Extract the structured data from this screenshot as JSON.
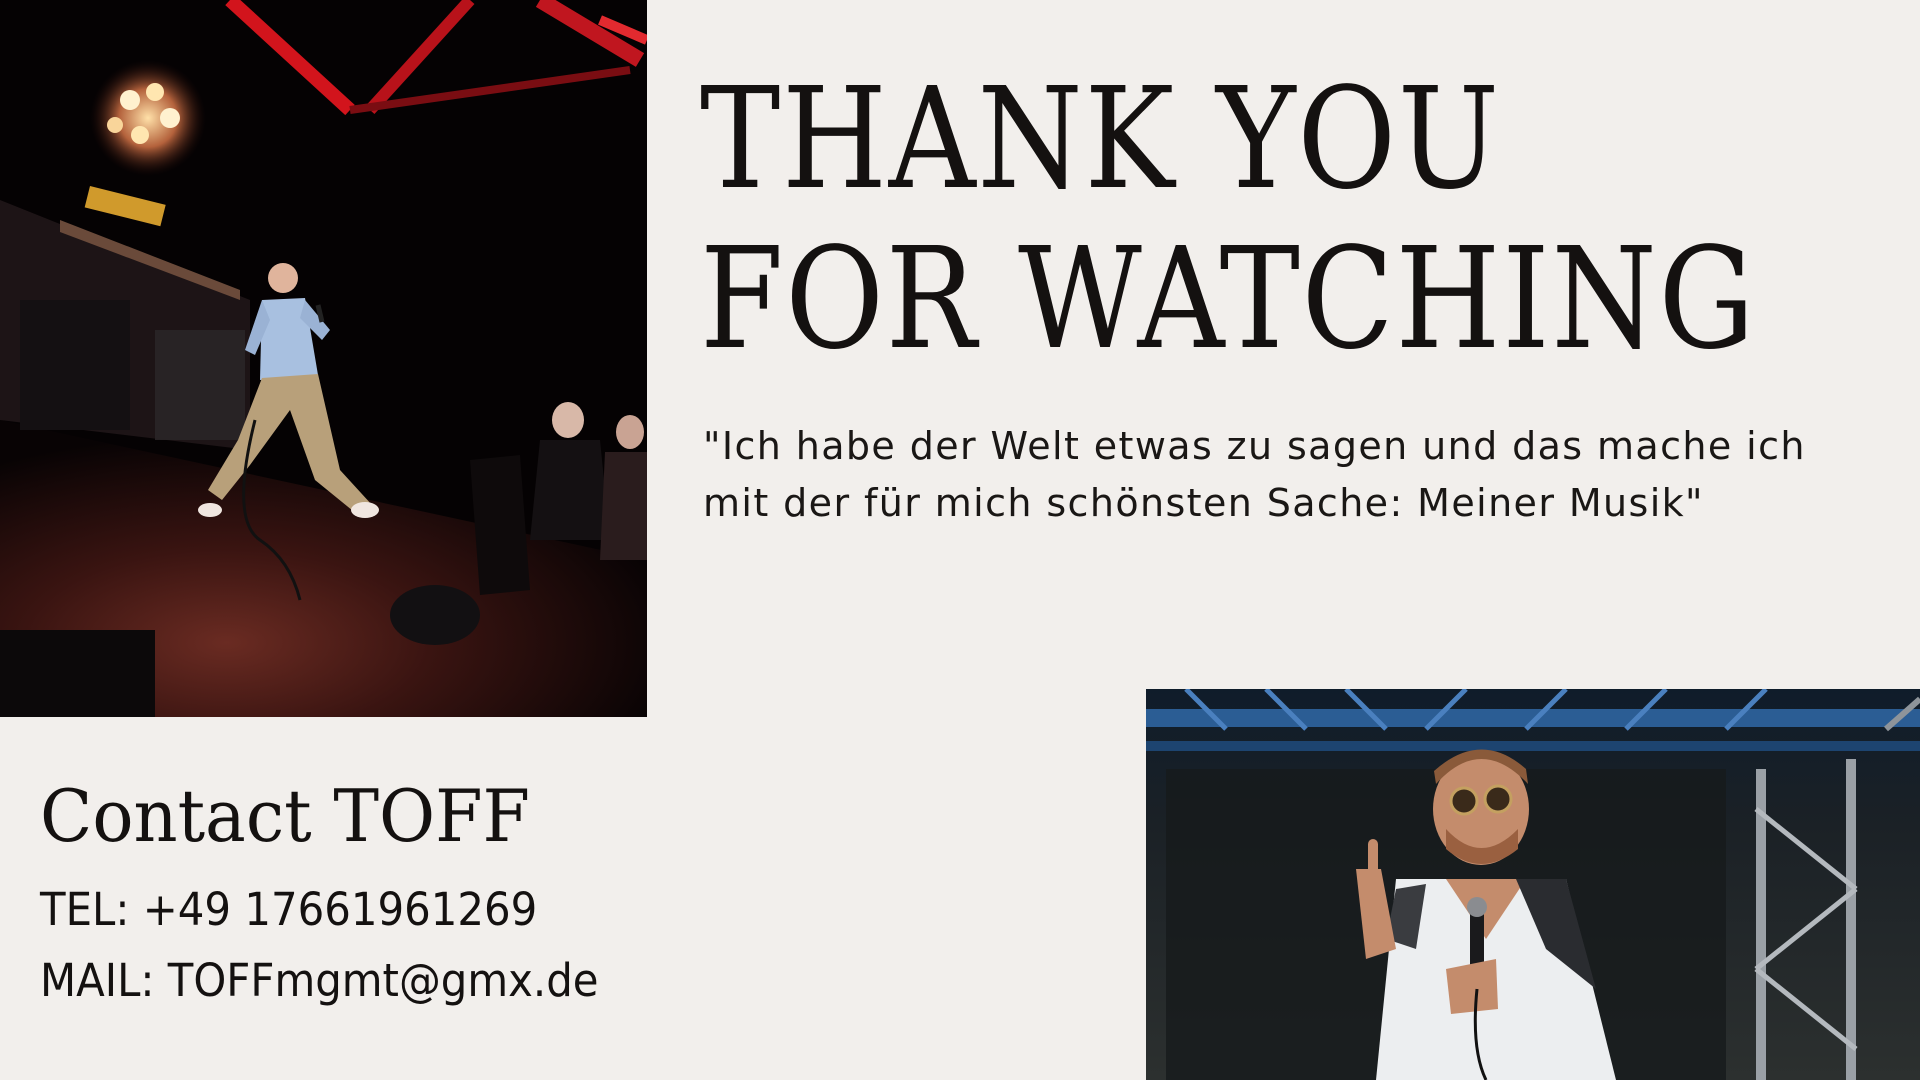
{
  "headline": {
    "line1": "THANK YOU",
    "line2": "FOR WATCHING"
  },
  "quote": {
    "line1": "\"Ich habe der Welt etwas zu sagen und das mache ich",
    "line2": "mit der für mich schönsten Sache: Meiner Musik\""
  },
  "contact": {
    "title": "Contact TOFF",
    "tel": "TEL: +49 17661961269",
    "mail": "MAIL: TOFFmgmt@gmx.de"
  },
  "photos": {
    "stage_photo": "photo-stage-club",
    "portrait_photo": "photo-performer-microphone"
  },
  "colors": {
    "background": "#f2efec",
    "text": "#141110",
    "stage_red": "#c0161f"
  }
}
